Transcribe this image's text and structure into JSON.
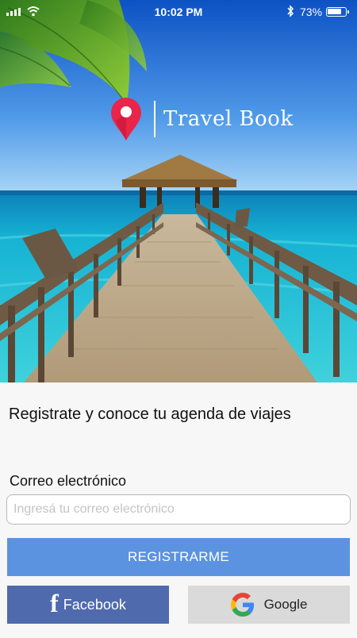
{
  "status_bar": {
    "time": "10:02 PM",
    "battery_percent": "73%",
    "battery_level": 0.73,
    "icons": [
      "signal-icon",
      "wifi-icon",
      "bluetooth-icon",
      "battery-icon"
    ]
  },
  "hero": {
    "icon": "map-pin-icon",
    "app_name": "Travel Book"
  },
  "tagline": "Registrate y conoce tu agenda de viajes",
  "email": {
    "label": "Correo electrónico",
    "placeholder": "Ingresá tu correo electrónico",
    "value": ""
  },
  "buttons": {
    "register": "REGISTRARME",
    "facebook": "Facebook",
    "google": "Google"
  },
  "colors": {
    "register_bg": "#5b93e0",
    "facebook_bg": "#4f6aad",
    "google_bg": "#dadada",
    "pin_red": "#e8264a"
  }
}
